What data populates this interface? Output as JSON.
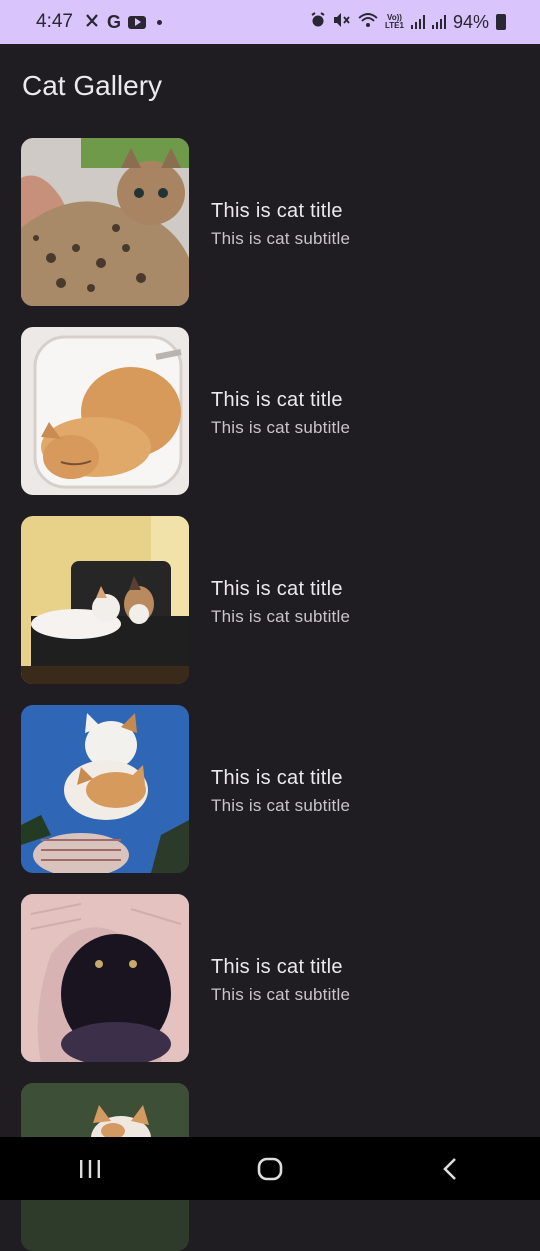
{
  "status_bar": {
    "time": "4:47",
    "left_icons": [
      "person-walk-icon",
      "google-icon",
      "youtube-icon",
      "dot-icon"
    ],
    "g_letter": "G",
    "right_icons": [
      "alarm-icon",
      "mute-icon",
      "wifi-icon",
      "volte-icon",
      "signal-icon",
      "signal-icon",
      "battery-icon"
    ],
    "volte_top": "Vo))",
    "volte_bottom": "LTE1",
    "battery_pct": "94%"
  },
  "header": {
    "title": "Cat Gallery"
  },
  "items": [
    {
      "title": "This is cat title",
      "subtitle": "This is cat subtitle",
      "image": "leopard-kitten"
    },
    {
      "title": "This is cat title",
      "subtitle": "This is cat subtitle",
      "image": "orange-cat-in-sink"
    },
    {
      "title": "This is cat title",
      "subtitle": "This is cat subtitle",
      "image": "two-cats-on-chair"
    },
    {
      "title": "This is cat title",
      "subtitle": "This is cat subtitle",
      "image": "stacked-cats-sky"
    },
    {
      "title": "This is cat title",
      "subtitle": "This is cat subtitle",
      "image": "black-cat-in-towel"
    },
    {
      "title": "",
      "subtitle": "",
      "image": "kitten-partial"
    }
  ],
  "nav_bar": {
    "buttons": [
      "recents-icon",
      "home-icon",
      "back-icon"
    ]
  }
}
